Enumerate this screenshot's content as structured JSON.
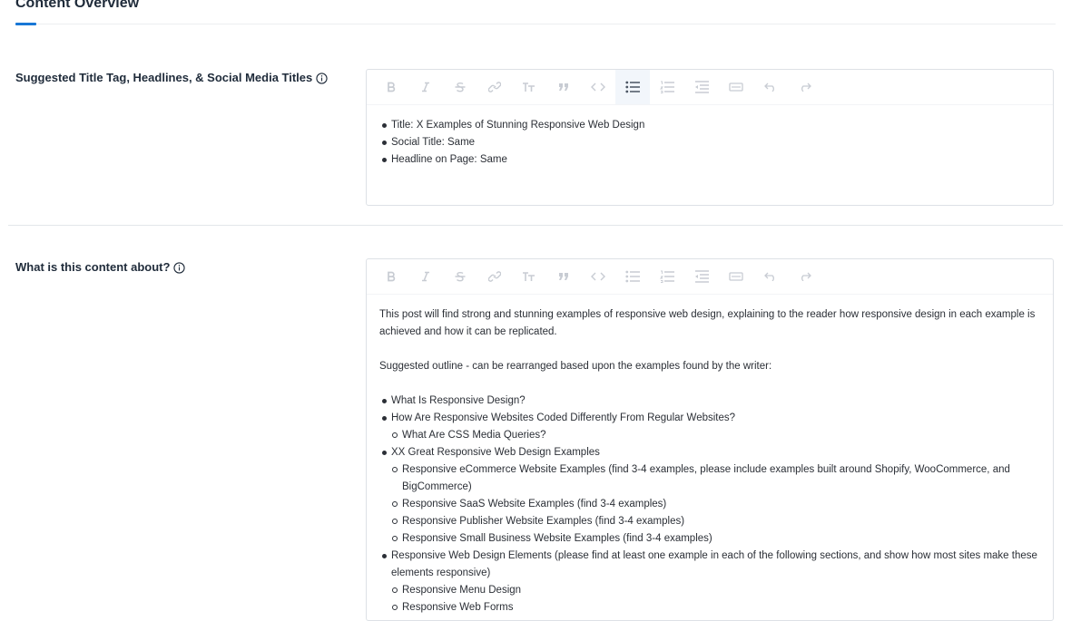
{
  "section": {
    "title": "Content Overview"
  },
  "toolbar_icons": [
    "bold-icon",
    "italic-icon",
    "strikethrough-icon",
    "link-icon",
    "heading-icon",
    "quote-icon",
    "code-icon",
    "bullet-list-icon",
    "numbered-list-icon",
    "outdent-icon",
    "indent-icon",
    "undo-icon",
    "redo-icon"
  ],
  "fields": {
    "title_tag": {
      "label": "Suggested Title Tag, Headlines, & Social Media Titles",
      "bullets": [
        "Title: X Examples of Stunning Responsive Web Design",
        "Social Title: Same",
        "Headline on Page: Same"
      ]
    },
    "about": {
      "label": "What is this content about?",
      "paragraph1": "This post will find strong and stunning examples of responsive web design, explaining to the reader how responsive design in each example is achieved and how it can be replicated.",
      "paragraph2": "Suggested outline - can be rearranged based upon the examples found by the writer:",
      "outline": [
        {
          "text": "What Is Responsive Design?",
          "children": []
        },
        {
          "text": "How Are Responsive Websites Coded Differently From Regular Websites?",
          "children": [
            "What Are CSS Media Queries?"
          ]
        },
        {
          "text": "XX Great Responsive Web Design Examples",
          "children": [
            "Responsive eCommerce Website Examples (find 3-4 examples, please include examples built around Shopify, WooCommerce, and BigCommerce)",
            "Responsive SaaS Website Examples (find 3-4 examples)",
            "Responsive Publisher Website Examples (find 3-4 examples)",
            "Responsive Small Business Website Examples (find 3-4 examples)"
          ]
        },
        {
          "text": "Responsive Web Design Elements (please find at least one example in each of the following sections, and show how most sites make these elements responsive)",
          "children": [
            "Responsive Menu Design",
            "Responsive Web Forms"
          ]
        }
      ]
    }
  }
}
